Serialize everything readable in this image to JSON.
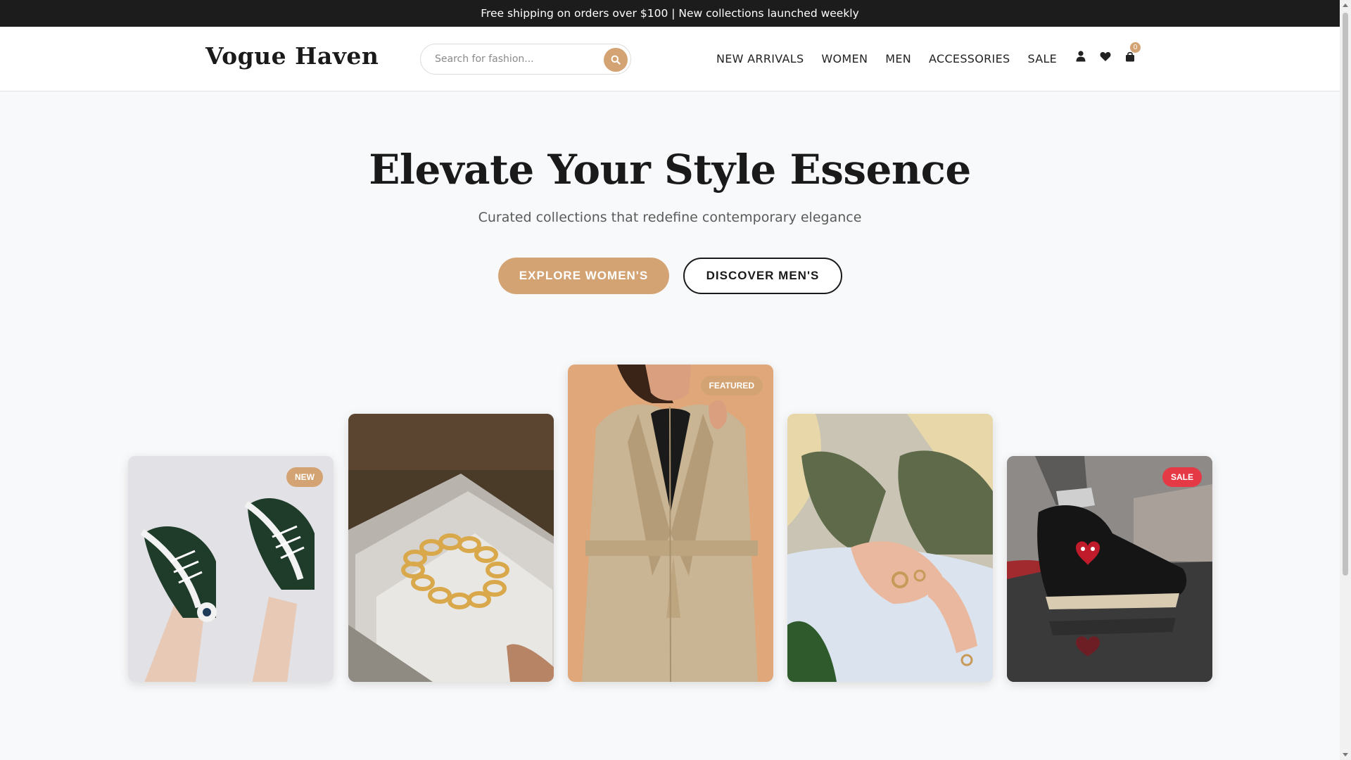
{
  "announcement": "Free shipping on orders over $100 | New collections launched weekly",
  "header": {
    "logo": "Vogue Haven",
    "search": {
      "placeholder": "Search for fashion...",
      "icon": "search-icon"
    },
    "nav": [
      "NEW ARRIVALS",
      "WOMEN",
      "MEN",
      "ACCESSORIES",
      "SALE"
    ],
    "icons": [
      "user-icon",
      "heart-icon",
      "shopping-bag-icon"
    ],
    "cart_count": "0"
  },
  "hero": {
    "title": "Elevate Your Style Essence",
    "subtitle": "Curated collections that redefine contemporary elegance",
    "primary_cta": "EXPLORE WOMEN'S",
    "secondary_cta": "DISCOVER MEN'S"
  },
  "gallery": [
    {
      "name": "green-high-top-sneakers",
      "badge": "NEW",
      "badge_color": "#d4a373"
    },
    {
      "name": "gold-chain-bracelet",
      "badge": ""
    },
    {
      "name": "beige-trench-coat",
      "badge": "FEATURED",
      "badge_color": "#d4a373"
    },
    {
      "name": "rings-knit-sleeves",
      "badge": ""
    },
    {
      "name": "black-heart-sneaker",
      "badge": "SALE",
      "badge_color": "#e63946"
    }
  ],
  "colors": {
    "accent": "#d4a373",
    "sale": "#e63946",
    "topbar": "#1c1c1c"
  }
}
